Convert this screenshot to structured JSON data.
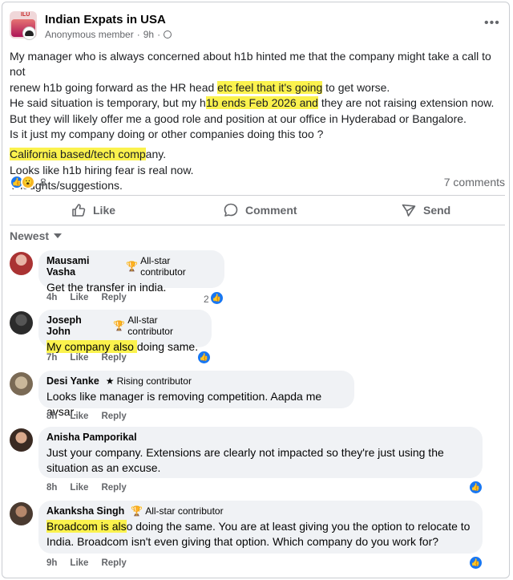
{
  "group": {
    "name": "Indian Expats in USA",
    "badge_text": "ILU",
    "author": "Anonymous member",
    "time": "9h",
    "more": "•••"
  },
  "post": {
    "lines": [
      {
        "pre": "My manager who is always concerned about h1b hinted me that the company might take a call to not",
        "hl": "",
        "post": ""
      },
      {
        "pre": "renew h1b going forward as the HR head ",
        "hl": "etc feel that it's going",
        "post": " to get worse."
      },
      {
        "pre": "He said situation is temporary, but my h",
        "hl": "1b ends Feb 2026 and",
        "post": " they are not raising extension now."
      },
      {
        "pre": "But they will likely offer me a good role and position at our office in Hyderabad or Bangalore.",
        "hl": "",
        "post": ""
      },
      {
        "pre": "Is it just my company doing or other companies doing this too ?",
        "hl": "",
        "post": ""
      },
      {
        "pre": "",
        "hl": "California based/tech comp",
        "post": "any."
      },
      {
        "pre": "Looks like h1b hiring fear is real now.",
        "hl": "",
        "post": ""
      },
      {
        "pre": "Thoughts/suggestions.",
        "hl": "",
        "post": ""
      }
    ],
    "reaction_count": "8",
    "comments_count": "7 comments"
  },
  "actions": {
    "like": "Like",
    "comment": "Comment",
    "send": "Send"
  },
  "sort_label": "Newest",
  "comments": [
    {
      "name": "Mausami Vasha",
      "badge": "All-star contributor",
      "badge_icon": "trophy-icon",
      "text_hl": "",
      "text": "Get the transfer in india.",
      "time": "4h",
      "like": "Like",
      "reply": "Reply",
      "reactions": "2"
    },
    {
      "name": "Joseph John",
      "badge": "All-star contributor",
      "badge_icon": "trophy-icon",
      "text_hl": "My company also ",
      "text": "doing same.",
      "time": "7h",
      "like": "Like",
      "reply": "Reply",
      "reactions": ""
    },
    {
      "name": "Desi Yanke",
      "badge": "Rising contributor",
      "badge_icon": "star-icon",
      "text_hl": "",
      "text": "Looks like manager is removing competition. Aapda me avsar.",
      "time": "8h",
      "like": "Like",
      "reply": "Reply",
      "reactions": ""
    },
    {
      "name": "Anisha Pamporikal",
      "badge": "",
      "badge_icon": "",
      "text_hl": "",
      "text": "Just your company. Extensions are clearly not impacted so they're just using the situation as an excuse.",
      "time": "8h",
      "like": "Like",
      "reply": "Reply",
      "reactions": ""
    },
    {
      "name": "Akanksha Singh",
      "badge": "All-star contributor",
      "badge_icon": "trophy-icon",
      "text_hl": "Broadcom is als",
      "text": "o doing the same. You are at least giving you the option to relocate to India. Broadcom isn't even giving that option. Which company do you work for?",
      "time": "9h",
      "like": "Like",
      "reply": "Reply",
      "reactions": ""
    }
  ],
  "colors": {
    "highlight": "#fbf24d",
    "facebook_blue": "#1877f2",
    "muted_text": "#65676b",
    "bubble_bg": "#f0f2f5"
  }
}
